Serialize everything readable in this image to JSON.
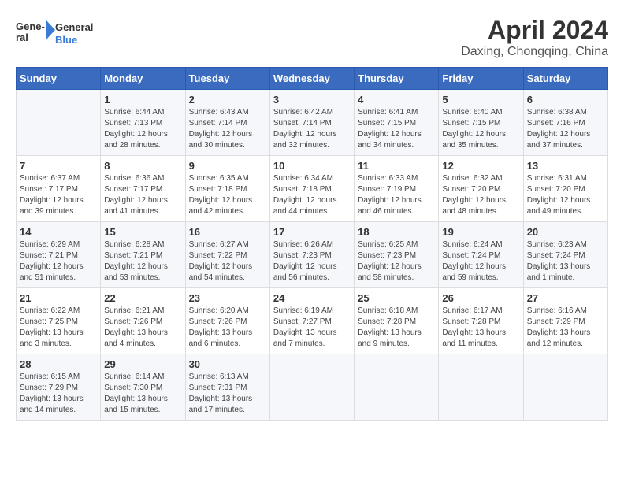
{
  "header": {
    "logo_line1": "General",
    "logo_line2": "Blue",
    "month_year": "April 2024",
    "location": "Daxing, Chongqing, China"
  },
  "days_of_week": [
    "Sunday",
    "Monday",
    "Tuesday",
    "Wednesday",
    "Thursday",
    "Friday",
    "Saturday"
  ],
  "weeks": [
    [
      {
        "day": "",
        "info": ""
      },
      {
        "day": "1",
        "info": "Sunrise: 6:44 AM\nSunset: 7:13 PM\nDaylight: 12 hours\nand 28 minutes."
      },
      {
        "day": "2",
        "info": "Sunrise: 6:43 AM\nSunset: 7:14 PM\nDaylight: 12 hours\nand 30 minutes."
      },
      {
        "day": "3",
        "info": "Sunrise: 6:42 AM\nSunset: 7:14 PM\nDaylight: 12 hours\nand 32 minutes."
      },
      {
        "day": "4",
        "info": "Sunrise: 6:41 AM\nSunset: 7:15 PM\nDaylight: 12 hours\nand 34 minutes."
      },
      {
        "day": "5",
        "info": "Sunrise: 6:40 AM\nSunset: 7:15 PM\nDaylight: 12 hours\nand 35 minutes."
      },
      {
        "day": "6",
        "info": "Sunrise: 6:38 AM\nSunset: 7:16 PM\nDaylight: 12 hours\nand 37 minutes."
      }
    ],
    [
      {
        "day": "7",
        "info": "Sunrise: 6:37 AM\nSunset: 7:17 PM\nDaylight: 12 hours\nand 39 minutes."
      },
      {
        "day": "8",
        "info": "Sunrise: 6:36 AM\nSunset: 7:17 PM\nDaylight: 12 hours\nand 41 minutes."
      },
      {
        "day": "9",
        "info": "Sunrise: 6:35 AM\nSunset: 7:18 PM\nDaylight: 12 hours\nand 42 minutes."
      },
      {
        "day": "10",
        "info": "Sunrise: 6:34 AM\nSunset: 7:18 PM\nDaylight: 12 hours\nand 44 minutes."
      },
      {
        "day": "11",
        "info": "Sunrise: 6:33 AM\nSunset: 7:19 PM\nDaylight: 12 hours\nand 46 minutes."
      },
      {
        "day": "12",
        "info": "Sunrise: 6:32 AM\nSunset: 7:20 PM\nDaylight: 12 hours\nand 48 minutes."
      },
      {
        "day": "13",
        "info": "Sunrise: 6:31 AM\nSunset: 7:20 PM\nDaylight: 12 hours\nand 49 minutes."
      }
    ],
    [
      {
        "day": "14",
        "info": "Sunrise: 6:29 AM\nSunset: 7:21 PM\nDaylight: 12 hours\nand 51 minutes."
      },
      {
        "day": "15",
        "info": "Sunrise: 6:28 AM\nSunset: 7:21 PM\nDaylight: 12 hours\nand 53 minutes."
      },
      {
        "day": "16",
        "info": "Sunrise: 6:27 AM\nSunset: 7:22 PM\nDaylight: 12 hours\nand 54 minutes."
      },
      {
        "day": "17",
        "info": "Sunrise: 6:26 AM\nSunset: 7:23 PM\nDaylight: 12 hours\nand 56 minutes."
      },
      {
        "day": "18",
        "info": "Sunrise: 6:25 AM\nSunset: 7:23 PM\nDaylight: 12 hours\nand 58 minutes."
      },
      {
        "day": "19",
        "info": "Sunrise: 6:24 AM\nSunset: 7:24 PM\nDaylight: 12 hours\nand 59 minutes."
      },
      {
        "day": "20",
        "info": "Sunrise: 6:23 AM\nSunset: 7:24 PM\nDaylight: 13 hours\nand 1 minute."
      }
    ],
    [
      {
        "day": "21",
        "info": "Sunrise: 6:22 AM\nSunset: 7:25 PM\nDaylight: 13 hours\nand 3 minutes."
      },
      {
        "day": "22",
        "info": "Sunrise: 6:21 AM\nSunset: 7:26 PM\nDaylight: 13 hours\nand 4 minutes."
      },
      {
        "day": "23",
        "info": "Sunrise: 6:20 AM\nSunset: 7:26 PM\nDaylight: 13 hours\nand 6 minutes."
      },
      {
        "day": "24",
        "info": "Sunrise: 6:19 AM\nSunset: 7:27 PM\nDaylight: 13 hours\nand 7 minutes."
      },
      {
        "day": "25",
        "info": "Sunrise: 6:18 AM\nSunset: 7:28 PM\nDaylight: 13 hours\nand 9 minutes."
      },
      {
        "day": "26",
        "info": "Sunrise: 6:17 AM\nSunset: 7:28 PM\nDaylight: 13 hours\nand 11 minutes."
      },
      {
        "day": "27",
        "info": "Sunrise: 6:16 AM\nSunset: 7:29 PM\nDaylight: 13 hours\nand 12 minutes."
      }
    ],
    [
      {
        "day": "28",
        "info": "Sunrise: 6:15 AM\nSunset: 7:29 PM\nDaylight: 13 hours\nand 14 minutes."
      },
      {
        "day": "29",
        "info": "Sunrise: 6:14 AM\nSunset: 7:30 PM\nDaylight: 13 hours\nand 15 minutes."
      },
      {
        "day": "30",
        "info": "Sunrise: 6:13 AM\nSunset: 7:31 PM\nDaylight: 13 hours\nand 17 minutes."
      },
      {
        "day": "",
        "info": ""
      },
      {
        "day": "",
        "info": ""
      },
      {
        "day": "",
        "info": ""
      },
      {
        "day": "",
        "info": ""
      }
    ]
  ]
}
